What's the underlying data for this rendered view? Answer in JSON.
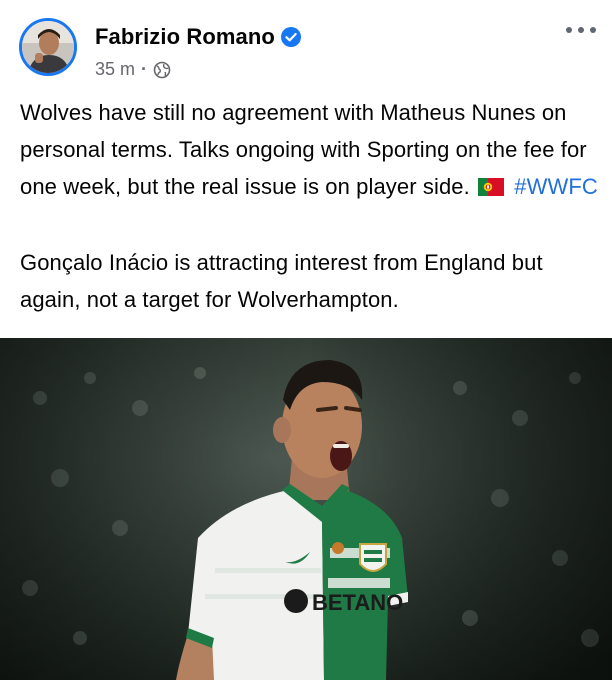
{
  "post": {
    "author": "Fabrizio Romano",
    "time": "35 m",
    "separator": "·",
    "paragraph1_text": "Wolves have still no agreement with Matheus Nunes on personal terms. Talks ongoing with Sporting on the fee for one week, but the real issue is on player side.",
    "flag_icon": "portugal-flag-icon",
    "hashtag": "#WWFC",
    "paragraph2_text": "Gonçalo Inácio is attracting interest from England but again, not a target for Wolverhampton."
  },
  "photo": {
    "sponsor_text": "BETANO"
  },
  "colors": {
    "verified_blue": "#1877f2",
    "hashtag_blue": "#216fdb",
    "meta_grey": "#65676b",
    "shirt_green": "#1f7a45"
  },
  "icons": {
    "verified": "verified-badge-icon",
    "audience": "globe-icon",
    "more": "more-options-icon"
  }
}
